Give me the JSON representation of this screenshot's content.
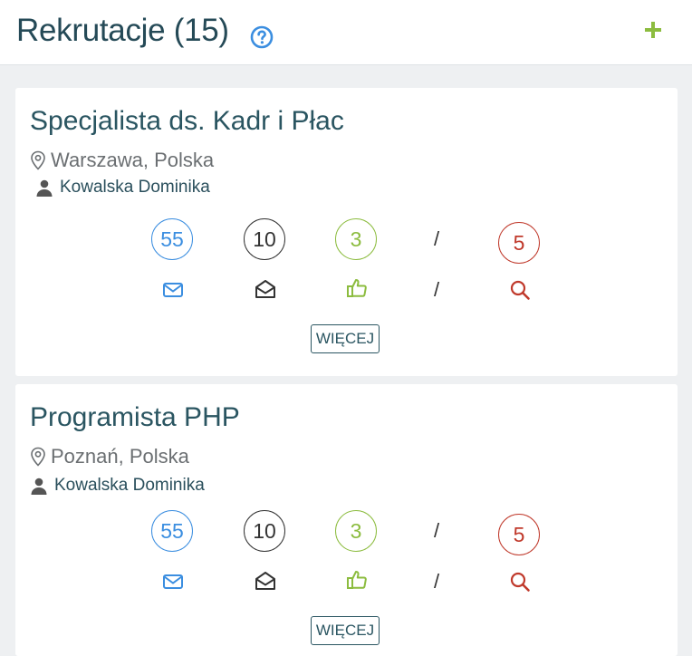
{
  "header": {
    "title": "Rekrutacje (15)",
    "help_icon": "question-circle-icon",
    "add_icon": "plus-icon"
  },
  "colors": {
    "received": "#3b8ee0",
    "read": "#333333",
    "accepted": "#8cbc3f",
    "search": "#c0392b",
    "title": "#254a57"
  },
  "recruitments": [
    {
      "title": "Specjalista ds. Kadr i Płac",
      "location": "Warszawa, Polska",
      "owner": "Kowalska Dominika",
      "stats": {
        "received": "55",
        "read": "10",
        "accepted": "3",
        "separator": "/",
        "search": "5"
      },
      "more_label": "WIĘCEJ"
    },
    {
      "title": "Programista PHP",
      "location": "Poznań, Polska",
      "owner": "Kowalska Dominika",
      "stats": {
        "received": "55",
        "read": "10",
        "accepted": "3",
        "separator": "/",
        "search": "5"
      },
      "more_label": "WIĘCEJ"
    }
  ]
}
